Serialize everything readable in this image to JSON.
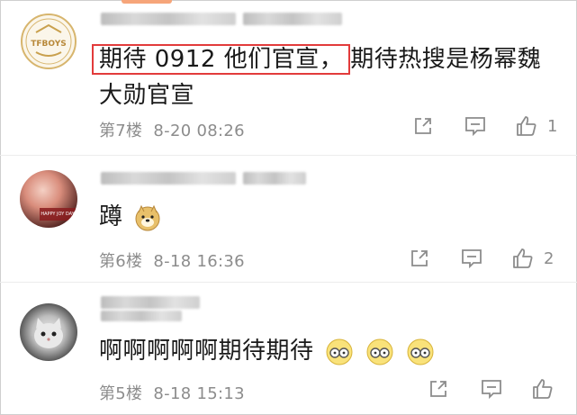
{
  "comments": [
    {
      "avatar_text": "TFBOYS",
      "text_highlight": "期待 0912 他们官宣，",
      "text_rest": "期待热搜是杨幂魏大勋官宣",
      "floor": "第7楼",
      "time": "8-20 08:26",
      "like_count": "1"
    },
    {
      "avatar_text": "HAPPY JOY DAY",
      "text": "蹲",
      "floor": "第6楼",
      "time": "8-18 16:36",
      "like_count": "2"
    },
    {
      "text": "啊啊啊啊啊期待期待",
      "floor": "第5楼",
      "time": "8-18 15:13",
      "like_count": ""
    }
  ],
  "colors": {
    "highlight_border": "#e23b3b",
    "meta_gray": "#8c8c8c",
    "accent": "#f6a57a"
  }
}
